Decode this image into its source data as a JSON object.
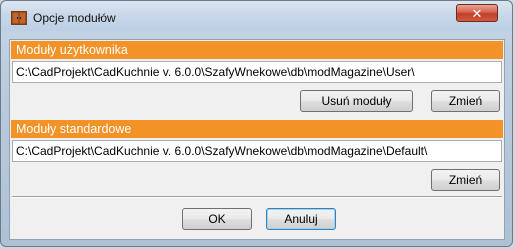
{
  "window": {
    "title": "Opcje modułów",
    "close_glyph": "✕"
  },
  "user_modules": {
    "header": "Moduły użytkownika",
    "path": "C:\\CadProjekt\\CadKuchnie v. 6.0.0\\SzafyWnekowe\\db\\modMagazine\\User\\",
    "remove_label": "Usuń moduły",
    "change_label": "Zmień"
  },
  "standard_modules": {
    "header": "Moduły standardowe",
    "path": "C:\\CadProjekt\\CadKuchnie v. 6.0.0\\SzafyWnekowe\\db\\modMagazine\\Default\\",
    "change_label": "Zmień"
  },
  "footer": {
    "ok_label": "OK",
    "cancel_label": "Anuluj"
  },
  "colors": {
    "section_header": "#f29227",
    "close_button": "#c0402a"
  },
  "icons": {
    "app": "cabinet-icon",
    "close": "close-icon"
  }
}
